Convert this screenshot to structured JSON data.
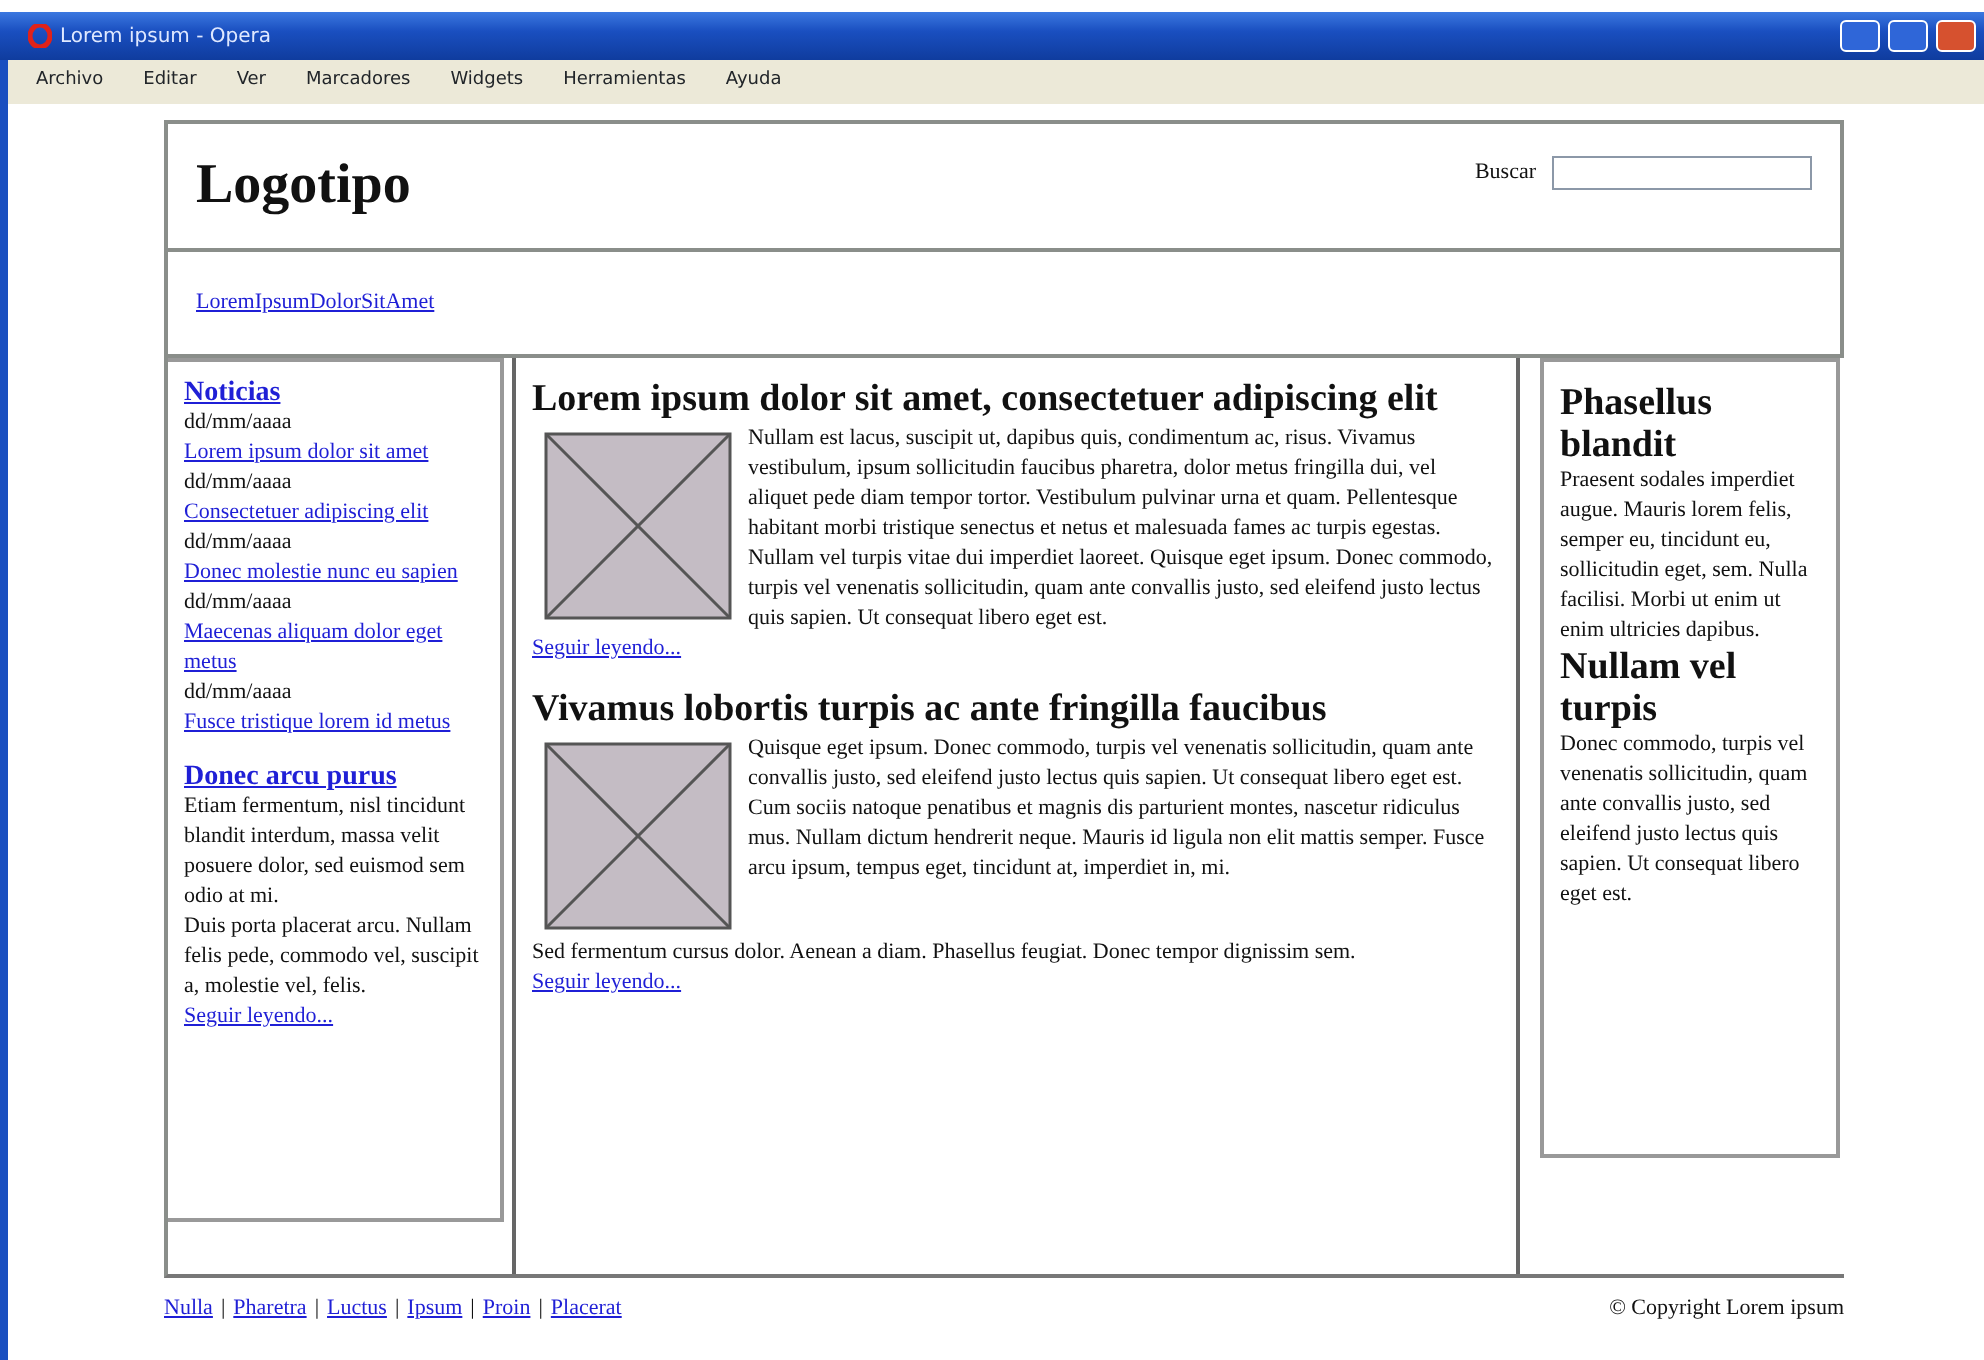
{
  "window": {
    "title": "Lorem ipsum - Opera",
    "menu": [
      "Archivo",
      "Editar",
      "Ver",
      "Marcadores",
      "Widgets",
      "Herramientas",
      "Ayuda"
    ]
  },
  "header": {
    "logo": "Logotipo",
    "search_label": "Buscar"
  },
  "nav": {
    "link": "LoremIpsumDolorSitAmet"
  },
  "sidebar": {
    "news_title": "Noticias",
    "news": [
      {
        "date": "dd/mm/aaaa",
        "link": "Lorem ipsum dolor sit amet"
      },
      {
        "date": "dd/mm/aaaa",
        "link": "Consectetuer adipiscing elit"
      },
      {
        "date": "dd/mm/aaaa",
        "link": "Donec molestie nunc eu sapien"
      },
      {
        "date": "dd/mm/aaaa",
        "link": "Maecenas aliquam dolor eget metus"
      },
      {
        "date": "dd/mm/aaaa",
        "link": "Fusce tristique lorem id metus"
      }
    ],
    "section_title": "Donec arcu purus",
    "paragraphs": [
      "Etiam fermentum, nisl tincidunt blandit interdum, massa velit posuere dolor, sed euismod sem odio at mi.",
      "Duis porta placerat arcu. Nullam felis pede, commodo vel, suscipit a, molestie vel, felis."
    ],
    "more_link": "Seguir leyendo..."
  },
  "articles": [
    {
      "title": "Lorem ipsum dolor sit amet, consectetuer adipiscing elit",
      "paragraphs": [
        "Nullam est lacus, suscipit ut, dapibus quis, condimentum ac, risus. Vivamus vestibulum, ipsum sollicitudin faucibus pharetra, dolor metus fringilla dui, vel aliquet pede diam tempor tortor. Vestibulum pulvinar urna et quam. Pellentesque habitant morbi tristique senectus et netus et malesuada fames ac turpis egestas. Nullam vel turpis vitae dui imperdiet laoreet. Quisque eget ipsum. Donec commodo, turpis vel venenatis sollicitudin, quam ante convallis justo, sed eleifend justo lectus quis sapien. Ut consequat libero eget est."
      ],
      "more_link": "Seguir leyendo..."
    },
    {
      "title": "Vivamus lobortis turpis ac ante fringilla faucibus",
      "paragraphs": [
        "Quisque eget ipsum. Donec commodo, turpis vel venenatis sollicitudin, quam ante convallis justo, sed eleifend justo lectus quis sapien. Ut consequat libero eget est.",
        "Cum sociis natoque penatibus et magnis dis parturient montes, nascetur ridiculus mus. Nullam dictum hendrerit neque. Mauris id ligula non elit mattis semper. Fusce arcu ipsum, tempus eget, tincidunt at, imperdiet in, mi.",
        "Sed fermentum cursus dolor. Aenean a diam. Phasellus feugiat. Donec tempor dignissim sem."
      ],
      "more_link": "Seguir leyendo..."
    }
  ],
  "aside": [
    {
      "title": "Phasellus blandit",
      "text": "Praesent sodales imperdiet augue. Mauris lorem felis, semper eu, tincidunt eu, sollicitudin eget, sem. Nulla facilisi. Morbi ut enim ut enim ultricies dapibus."
    },
    {
      "title": "Nullam vel turpis",
      "text": "Donec commodo, turpis vel venenatis sollicitudin, quam ante convallis justo, sed eleifend justo lectus quis sapien. Ut consequat libero eget est."
    }
  ],
  "footer": {
    "items": [
      {
        "kind": "link",
        "text": "Nulla"
      },
      {
        "kind": "sep",
        "text": "|"
      },
      {
        "kind": "link",
        "text": "Pharetra"
      },
      {
        "kind": "sep",
        "text": "|"
      },
      {
        "kind": "link",
        "text": "Luctus"
      },
      {
        "kind": "sep",
        "text": "|"
      },
      {
        "kind": "link",
        "text": "Ipsum"
      },
      {
        "kind": "sep",
        "text": "|"
      },
      {
        "kind": "link",
        "text": "Proin"
      },
      {
        "kind": "sep",
        "text": "|"
      },
      {
        "kind": "link",
        "text": "Placerat"
      }
    ],
    "copyright": "© Copyright Lorem ipsum"
  }
}
